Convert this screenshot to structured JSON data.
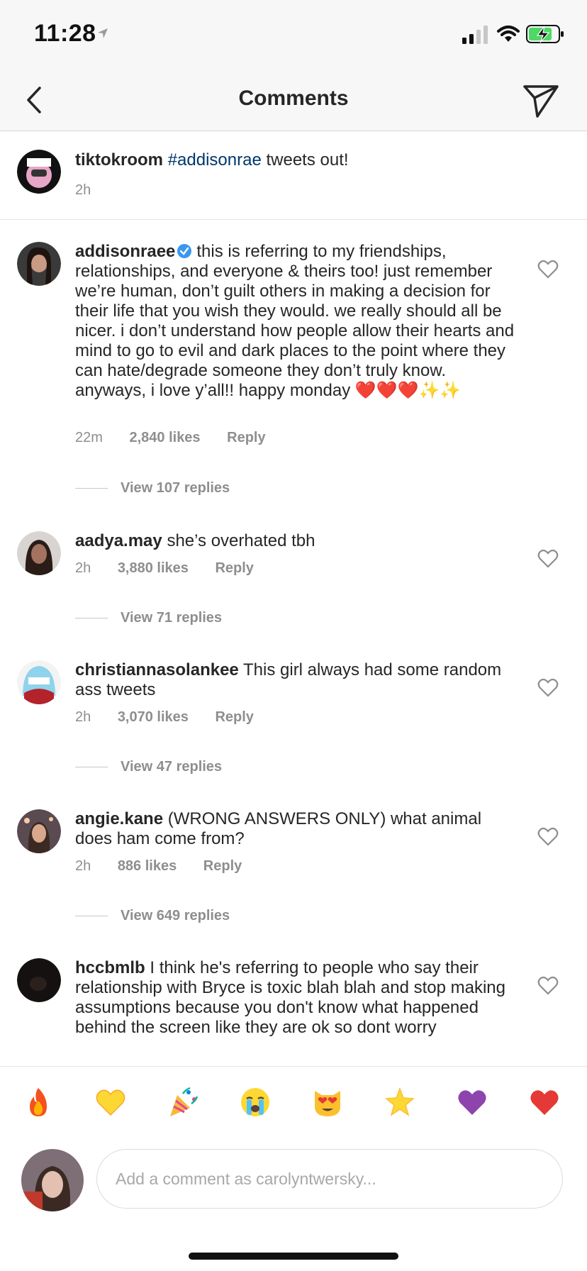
{
  "status_bar": {
    "time": "11:28"
  },
  "header": {
    "title": "Comments"
  },
  "caption": {
    "username": "tiktokroom",
    "hashtag": "#addisonrae",
    "text": "tweets out!",
    "time": "2h"
  },
  "comments": [
    {
      "username": "addisonraee",
      "verified": true,
      "text": "this is referring to my friendships, relationships, and everyone & theirs too! just remember we’re human, don’t guilt others in making a decision for their life that you wish they would. we really should all be nicer. i don’t understand how people allow their hearts and mind to go to evil and dark places to the point where they can hate/degrade someone they don’t truly know. anyways, i love y’all!! happy monday ❤️❤️❤️✨✨",
      "time": "22m",
      "likes": "2,840 likes",
      "reply": "Reply",
      "view_replies": "View 107 replies"
    },
    {
      "username": "aadya.may",
      "text": "she’s overhated tbh",
      "time": "2h",
      "likes": "3,880 likes",
      "reply": "Reply",
      "view_replies": "View 71 replies"
    },
    {
      "username": "christiannasolankee",
      "text": "This girl always had some random ass tweets",
      "time": "2h",
      "likes": "3,070 likes",
      "reply": "Reply",
      "view_replies": "View 47 replies"
    },
    {
      "username": "angie.kane",
      "text": "(WRONG ANSWERS ONLY) what animal does ham come from?",
      "time": "2h",
      "likes": "886 likes",
      "reply": "Reply",
      "view_replies": "View 649 replies"
    },
    {
      "username": "hccbmlb",
      "text": "I think he's referring to people who say their relationship with Bryce is toxic blah blah and stop making assumptions because you don't know what happened behind the screen like they are ok so dont worry"
    }
  ],
  "emoji_bar": [
    "fire",
    "yellow-heart",
    "party-popper",
    "crying-face",
    "heart-eyes-cat",
    "glowing-star",
    "purple-heart",
    "red-heart"
  ],
  "compose": {
    "placeholder": "Add a comment as carolyntwersky..."
  },
  "colors": {
    "link": "#00376b",
    "secondary_text": "#8e8e8e",
    "verified": "#3897f0"
  }
}
